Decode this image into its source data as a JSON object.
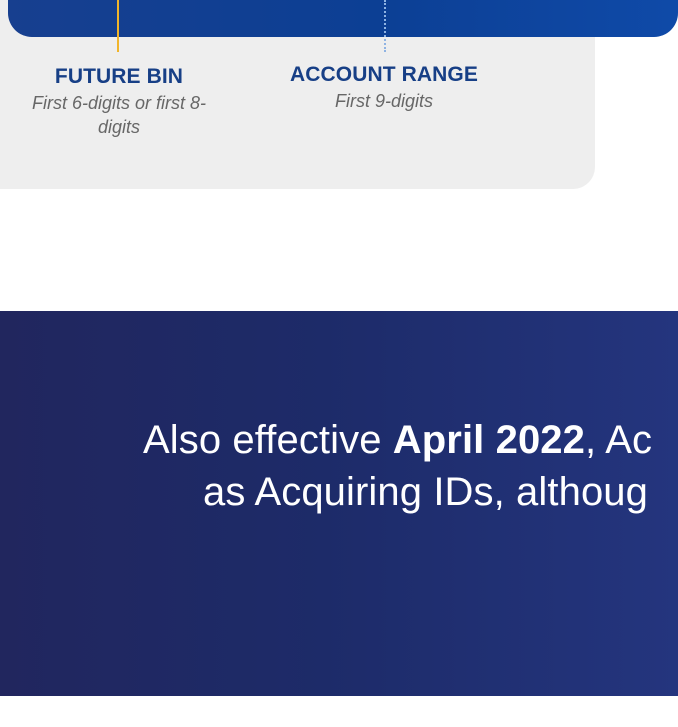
{
  "bin_label": {
    "title": "FUTURE BIN",
    "subtitle": "First 6-digits or first 8-digits"
  },
  "account_range_label": {
    "title": "ACCOUNT RANGE",
    "subtitle": "First 9-digits"
  },
  "banner": {
    "line_1_prefix": "Also effective ",
    "line_1_date": "April 2022",
    "line_1_suffix": ", Ac",
    "line_2": "as Acquiring IDs, althoug"
  },
  "colors": {
    "top_bar": "#0c3f94",
    "grey_card": "#eeeeee",
    "bin_line": "#f1b52b",
    "account_line": "#8fb3e3",
    "label_blue": "#173f86",
    "subtitle_grey": "#676767",
    "banner_navy": "#1d2b69"
  }
}
